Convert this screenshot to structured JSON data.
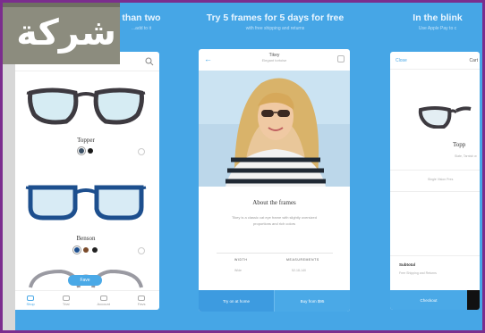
{
  "overlay": {
    "text": "شركة نـ"
  },
  "captions": [
    {
      "title": "than two",
      "subtitle": "...add to it"
    },
    {
      "title": "Try 5 frames for 5 days for free",
      "subtitle": "with free shipping and returns"
    },
    {
      "title": "In the blink",
      "subtitle": "Use Apple Pay to c"
    }
  ],
  "phone1": {
    "products": [
      {
        "name": "Topper",
        "swatch_colors": [
          "#3b4f64",
          "#1a1a1a"
        ]
      },
      {
        "name": "Benson",
        "swatch_colors": [
          "#1d4f8e",
          "#7a4a2a",
          "#222222"
        ]
      }
    ],
    "try_label": "Fave",
    "tabs": [
      {
        "icon": "glasses-icon",
        "label": "Shop"
      },
      {
        "icon": "grid-icon",
        "label": "Trial"
      },
      {
        "icon": "store-icon",
        "label": "Account"
      },
      {
        "icon": "heart-icon",
        "label": "Favs"
      }
    ]
  },
  "phone2": {
    "header_title": "Tikey",
    "header_subtitle": "Elegant tortoise",
    "about_title": "About the frames",
    "about_body": "Tikey is a classic cat eye frame with slightly oversized proportions and rich colors",
    "spec_headers": [
      "WIDTH",
      "MEASUREMENTS"
    ],
    "spec_values": [
      "Wide",
      "52-18-140"
    ],
    "btn_try": "Try on at home",
    "btn_buy": "Buy from $95"
  },
  "phone3": {
    "close_label": "Close",
    "cart_label": "Cart",
    "product_name": "Topp",
    "product_detail": "Slate, Tarnish w",
    "free_text": "Single Vision Pres",
    "subtotal_label": "Subtotal",
    "shipping_text": "Free Shipping and Returns",
    "checkout_label": "Checkout"
  }
}
